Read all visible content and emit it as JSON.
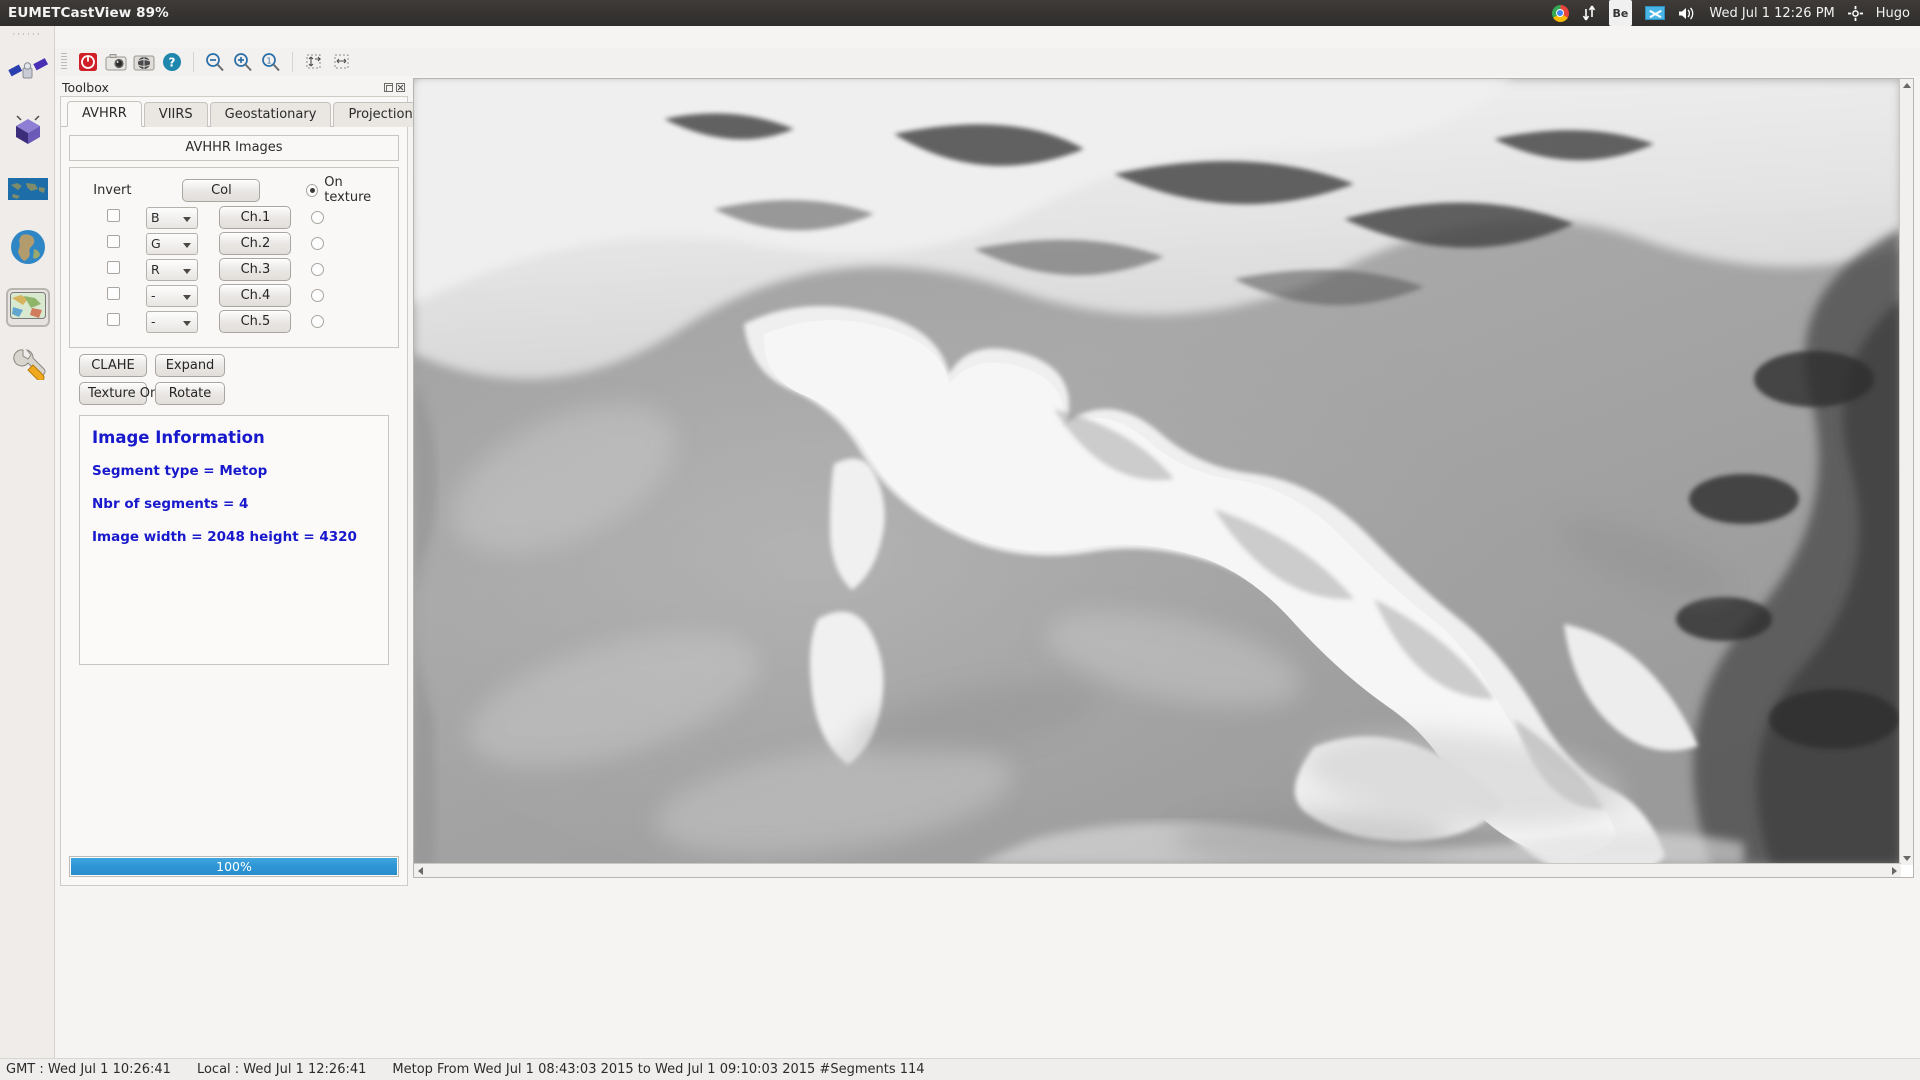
{
  "desktop": {
    "panel": {
      "app_title": "EUMETCastView 89%",
      "tray": {
        "chrome": "chrome-icon",
        "sync": "sync-arrows-icon",
        "be_indicator": "Be",
        "mail": "mail-icon",
        "volume": "volume-icon",
        "clock": "Wed Jul  1 12:26 PM",
        "session": "session-gear-icon",
        "user": "Hugo"
      }
    },
    "launcher": {
      "items": [
        {
          "name": "satellite-dish-icon",
          "label": "Satellite"
        },
        {
          "name": "satellite-box-icon",
          "label": "Satellite Box"
        },
        {
          "name": "world-map-strip-icon",
          "label": "World Map"
        },
        {
          "name": "globe-icon",
          "label": "Globe"
        },
        {
          "name": "map-viewer-icon",
          "label": "Map Viewer",
          "selected": true
        },
        {
          "name": "wrench-icon",
          "label": "Tools"
        }
      ]
    }
  },
  "toolbar": {
    "buttons": [
      {
        "name": "power-quit-icon",
        "label": "Quit"
      },
      {
        "name": "camera-icon",
        "label": "Snapshot"
      },
      {
        "name": "globe-snapshot-icon",
        "label": "Globe Snapshot"
      },
      {
        "name": "help-icon",
        "label": "Help"
      },
      {
        "name": "zoom-out-icon",
        "label": "Zoom Out"
      },
      {
        "name": "zoom-in-icon",
        "label": "Zoom In"
      },
      {
        "name": "zoom-one-to-one-icon",
        "label": "Zoom 1:1"
      },
      {
        "name": "fit-height-icon",
        "label": "Fit Height"
      },
      {
        "name": "fit-width-icon",
        "label": "Fit Width"
      }
    ]
  },
  "toolbox": {
    "title": "Toolbox",
    "window_buttons": {
      "float": "float-icon",
      "close": "close-icon"
    },
    "tabs": [
      {
        "label": "AVHRR",
        "active": true
      },
      {
        "label": "VIIRS",
        "active": false
      },
      {
        "label": "Geostationary",
        "active": false
      },
      {
        "label": "Projections",
        "active": false
      }
    ],
    "group_title": "AVHHR Images",
    "header": {
      "invert_label": "Invert",
      "col_button": "Col",
      "on_texture_label": "On texture",
      "on_texture_selected": true
    },
    "channels": [
      {
        "invert_checked": false,
        "color": "B",
        "button": "Ch.1",
        "radio_selected": false
      },
      {
        "invert_checked": false,
        "color": "G",
        "button": "Ch.2",
        "radio_selected": false
      },
      {
        "invert_checked": false,
        "color": "R",
        "button": "Ch.3",
        "radio_selected": false
      },
      {
        "invert_checked": false,
        "color": "-",
        "button": "Ch.4",
        "radio_selected": false
      },
      {
        "invert_checked": false,
        "color": "-",
        "button": "Ch.5",
        "radio_selected": false
      }
    ],
    "color_options": [
      "-",
      "R",
      "G",
      "B"
    ],
    "actions": [
      {
        "label": "CLAHE"
      },
      {
        "label": "Expand"
      },
      {
        "label": "Texture On"
      },
      {
        "label": "Rotate"
      }
    ],
    "info": {
      "title": "Image Information",
      "lines": [
        "Segment type = Metop",
        "Nbr of segments = 4",
        "Image width = 2048 height = 4320"
      ],
      "color": "#1818cc"
    },
    "progress": {
      "value": 100,
      "label": "100%",
      "color": "#2e95d4"
    }
  },
  "viewer": {
    "name": "satellite-image-viewport",
    "scrollbars": {
      "vertical": "vertical-scrollbar",
      "horizontal": "horizontal-scrollbar"
    }
  },
  "statusbar": {
    "gmt": "GMT : Wed Jul  1 10:26:41",
    "local": "Local : Wed Jul  1 12:26:41",
    "segment_info": "Metop From Wed Jul 1 08:43:03 2015 to Wed Jul 1 09:10:03 2015  #Segments 114"
  }
}
